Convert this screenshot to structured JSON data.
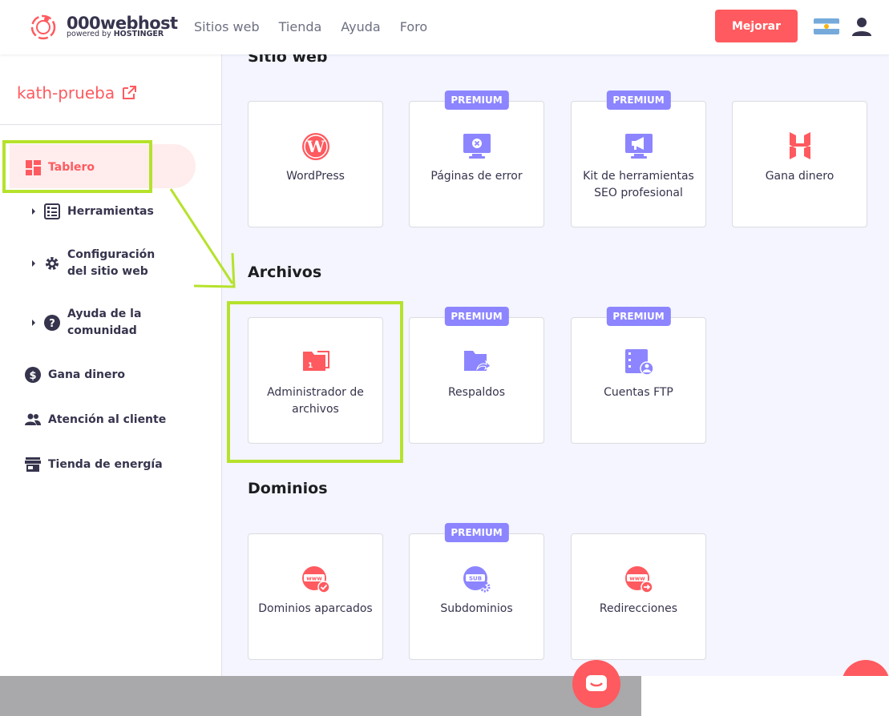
{
  "header": {
    "logo_name": "000webhost",
    "logo_sub_prefix": "powered by ",
    "logo_sub_brand": "HOSTINGER",
    "nav": [
      "Sitios web",
      "Tienda",
      "Ayuda",
      "Foro"
    ],
    "upgrade_label": "Mejorar",
    "language_flag": "argentina-flag-icon",
    "user_icon": "user-icon"
  },
  "sidebar": {
    "site_name": "kath-prueba",
    "site_icon": "external-link-icon",
    "items": [
      {
        "label": "Tablero",
        "icon": "dashboard-icon",
        "active": true
      },
      {
        "label": "Herramientas",
        "icon": "tools-icon",
        "expandable": true
      },
      {
        "label": "Configuración del sitio web",
        "icon": "gear-icon",
        "expandable": true
      },
      {
        "label": "Ayuda de la comunidad",
        "icon": "help-icon",
        "expandable": true
      },
      {
        "label": "Gana dinero",
        "icon": "dollar-icon"
      },
      {
        "label": "Atención al cliente",
        "icon": "people-icon"
      },
      {
        "label": "Tienda de energía",
        "icon": "store-icon"
      }
    ]
  },
  "main": {
    "sections": [
      {
        "title": "Sitio web",
        "cards": [
          {
            "label": "WordPress",
            "icon": "wordpress-icon",
            "premium": false
          },
          {
            "label": "Páginas de error",
            "icon": "error-page-icon",
            "premium": true
          },
          {
            "label": "Kit de herramientas SEO profesional",
            "icon": "seo-megaphone-icon",
            "premium": true
          },
          {
            "label": "Gana dinero",
            "icon": "hostinger-icon",
            "premium": false
          }
        ]
      },
      {
        "title": "Archivos",
        "cards": [
          {
            "label": "Administrador de archivos",
            "icon": "file-manager-icon",
            "premium": false
          },
          {
            "label": "Respaldos",
            "icon": "backup-icon",
            "premium": true
          },
          {
            "label": "Cuentas FTP",
            "icon": "ftp-icon",
            "premium": true
          }
        ]
      },
      {
        "title": "Dominios",
        "cards": [
          {
            "label": "Dominios aparcados",
            "icon": "parked-domain-icon",
            "premium": false
          },
          {
            "label": "Subdominios",
            "icon": "subdomain-icon",
            "premium": true
          },
          {
            "label": "Redirecciones",
            "icon": "redirect-icon",
            "premium": false
          }
        ]
      }
    ],
    "premium_label": "PREMIUM"
  },
  "colors": {
    "brand": "#ff5a5f",
    "premium": "#8c85ff",
    "highlight": "#b5e22b",
    "text": "#36344d"
  }
}
